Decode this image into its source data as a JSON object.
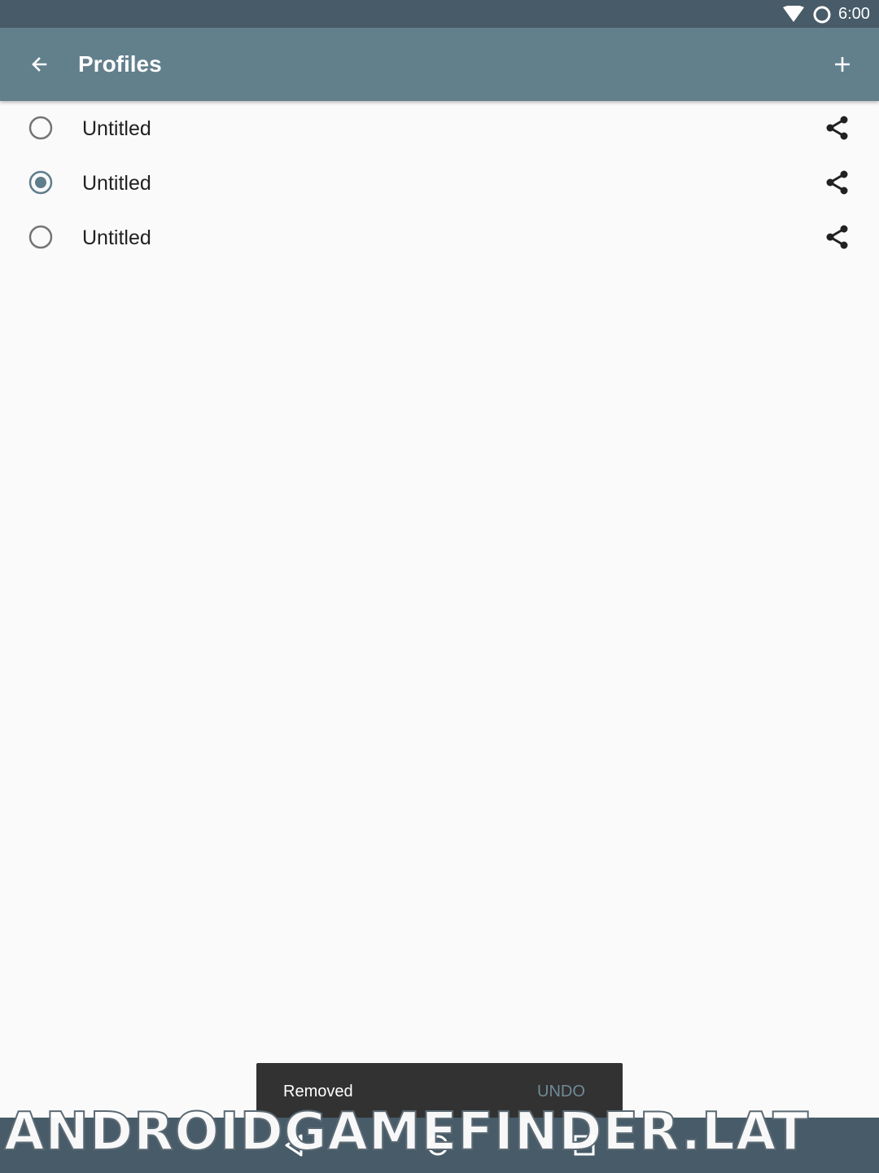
{
  "status_bar": {
    "time": "6:00",
    "icons": [
      "wifi-icon",
      "sync-icon"
    ]
  },
  "app_bar": {
    "title": "Profiles",
    "back_icon": "arrow-back-icon",
    "add_icon": "plus-icon"
  },
  "profiles": [
    {
      "name": "Untitled",
      "selected": false,
      "share_icon": "share-icon"
    },
    {
      "name": "Untitled",
      "selected": true,
      "share_icon": "share-icon"
    },
    {
      "name": "Untitled",
      "selected": false,
      "share_icon": "share-icon"
    }
  ],
  "snackbar": {
    "message": "Removed",
    "action": "UNDO"
  },
  "nav_bar": {
    "icons": [
      "nav-back-icon",
      "nav-home-icon",
      "nav-recents-icon"
    ]
  },
  "watermark": "ANDROIDGAMEFINDER.LAT",
  "colors": {
    "status_bar": "#475b68",
    "app_bar": "#627f8c",
    "accent": "#607d8b",
    "background": "#fafafa",
    "snackbar": "#323232",
    "snackbar_action": "#6f8b97"
  }
}
